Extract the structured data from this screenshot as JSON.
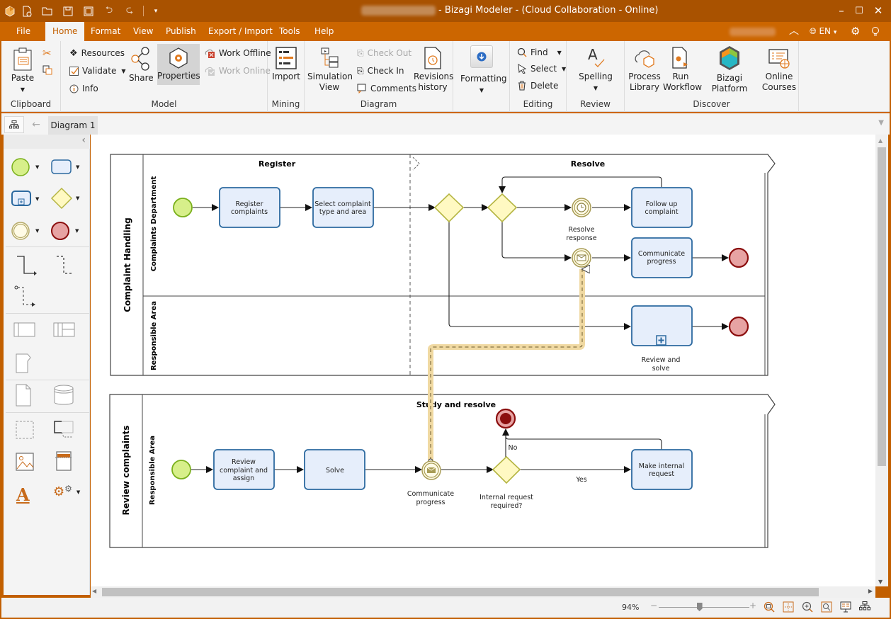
{
  "window": {
    "title": "- Bizagi Modeler - (Cloud Collaboration - Online)",
    "controls": {
      "minimize": "–",
      "maximize": "☐",
      "close": "✕"
    }
  },
  "quick_access": [
    "app-logo-icon",
    "new-file-icon",
    "open-file-icon",
    "save-icon",
    "save-as-icon",
    "undo-icon",
    "redo-icon",
    "customize-icon"
  ],
  "menu": {
    "items": [
      {
        "label": "File"
      },
      {
        "label": "Home",
        "active": true
      },
      {
        "label": "Format"
      },
      {
        "label": "View"
      },
      {
        "label": "Publish"
      },
      {
        "label": "Export / Import"
      },
      {
        "label": "Tools"
      },
      {
        "label": "Help"
      }
    ],
    "language": "EN"
  },
  "ribbon": {
    "clipboard": {
      "label": "Clipboard",
      "paste": "Paste"
    },
    "model": {
      "label": "Model",
      "resources": "Resources",
      "validate": "Validate",
      "info": "Info",
      "share": "Share",
      "properties": "Properties",
      "work_offline": "Work Offline",
      "work_online": "Work Online"
    },
    "mining": {
      "label": "Mining",
      "import": "Import"
    },
    "diagram": {
      "label": "Diagram",
      "simulation_view": [
        "Simulation",
        "View"
      ],
      "check_out": "Check Out",
      "check_in": "Check In",
      "comments": "Comments",
      "revisions_history": [
        "Revisions",
        "history"
      ]
    },
    "formatting": {
      "label": "Formatting"
    },
    "editing": {
      "label": "Editing",
      "find": "Find",
      "select": "Select",
      "delete": "Delete"
    },
    "review": {
      "label": "Review",
      "spelling": "Spelling"
    },
    "discover": {
      "label": "Discover",
      "process_library": [
        "Process",
        "Library"
      ],
      "run_workflow": [
        "Run",
        "Workflow"
      ],
      "bizagi_platform": "Bizagi Platform",
      "online_courses": [
        "Online",
        "Courses"
      ]
    }
  },
  "tabs": {
    "diagram_tab": "Diagram 1"
  },
  "diagram": {
    "pools": [
      {
        "name": "Complaint Handling",
        "lanes": [
          "Complaints Department",
          "Responsible Area"
        ],
        "phases": [
          "Register",
          "Resolve"
        ]
      },
      {
        "name": "Review complaints",
        "lanes": [
          "Responsible Area"
        ],
        "phases": [
          "Study and resolve"
        ]
      }
    ],
    "tasks": {
      "register_complaints": [
        "Register",
        "complaints"
      ],
      "select_complaint": [
        "Select complaint",
        "type and area"
      ],
      "follow_up": [
        "Follow up",
        "complaint"
      ],
      "communicate_progress": [
        "Communicate",
        "progress"
      ],
      "review_and_solve": [
        "Review and",
        "solve"
      ],
      "review_complaint_assign": [
        "Review",
        "complaint and",
        "assign"
      ],
      "solve": [
        "Solve"
      ],
      "make_internal_request": [
        "Make internal",
        "request"
      ]
    },
    "events": {
      "resolve_response": [
        "Resolve",
        "response"
      ],
      "communicate_progress_event": [
        "Communicate",
        "progress"
      ]
    },
    "gateways": {
      "internal_request": [
        "Internal request",
        "required?"
      ]
    },
    "flow_labels": {
      "no": "No",
      "yes": "Yes"
    }
  },
  "status": {
    "zoom": "94%",
    "zoom_slider_fraction": 0.45
  }
}
